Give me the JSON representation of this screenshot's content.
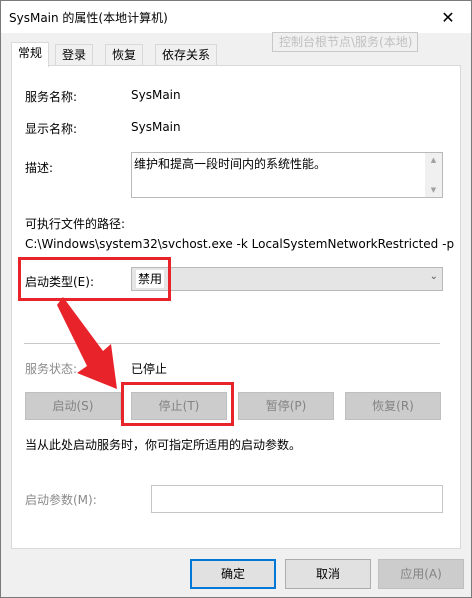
{
  "window": {
    "title": "SysMain 的属性(本地计算机)",
    "close_glyph": "✕"
  },
  "tooltip": "控制台根节点\\服务(本地)",
  "tabs": [
    {
      "label": "常规",
      "active": true
    },
    {
      "label": "登录",
      "active": false
    },
    {
      "label": "恢复",
      "active": false
    },
    {
      "label": "依存关系",
      "active": false
    }
  ],
  "general": {
    "service_name_label": "服务名称:",
    "service_name": "SysMain",
    "display_name_label": "显示名称:",
    "display_name": "SysMain",
    "description_label": "描述:",
    "description": "维护和提高一段时间内的系统性能。",
    "exe_path_label": "可执行文件的路径:",
    "exe_path": "C:\\Windows\\system32\\svchost.exe -k LocalSystemNetworkRestricted -p",
    "startup_type_label": "启动类型(E):",
    "startup_type_value": "禁用",
    "service_status_label": "服务状态:",
    "service_status_value": "已停止",
    "buttons": {
      "start": "启动(S)",
      "stop": "停止(T)",
      "pause": "暂停(P)",
      "resume": "恢复(R)"
    },
    "hint": "当从此处启动服务时，你可指定所适用的启动参数。",
    "start_params_label": "启动参数(M):",
    "start_params_value": ""
  },
  "footer": {
    "ok": "确定",
    "cancel": "取消",
    "apply": "应用(A)"
  },
  "colors": {
    "annotation_red": "#e8232a",
    "focus_blue": "#0078d7",
    "window_bg": "#f0f0f0"
  },
  "icons": {
    "close": "close-icon",
    "scroll_up": "scroll-up-icon",
    "scroll_down": "scroll-down-icon",
    "dropdown": "chevron-down-icon"
  }
}
